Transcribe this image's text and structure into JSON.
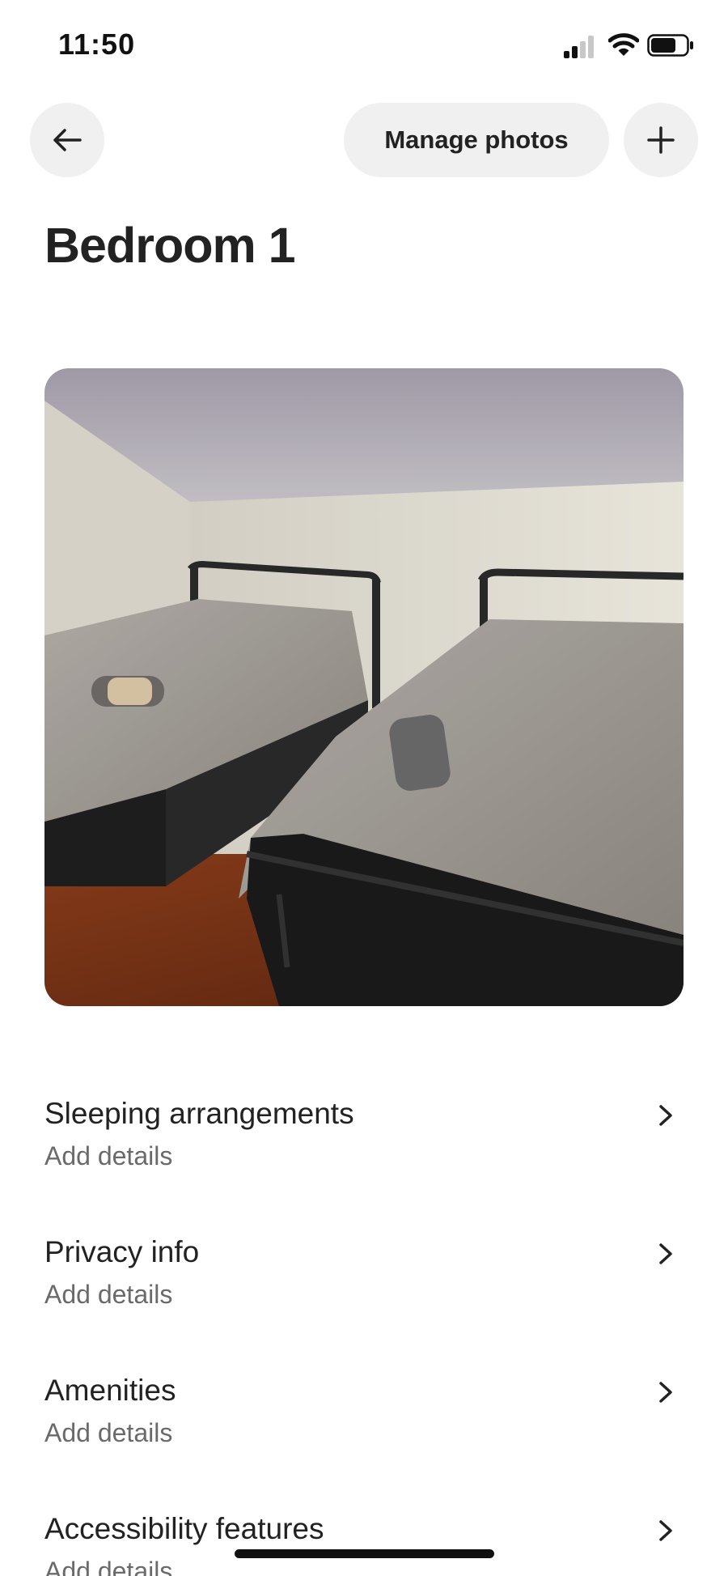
{
  "status_bar": {
    "time": "11:50",
    "icons": [
      "cellular-signal-icon",
      "wifi-icon",
      "battery-icon"
    ]
  },
  "header": {
    "back_icon": "arrow-left-icon",
    "manage_label": "Manage photos",
    "add_icon": "plus-icon"
  },
  "title": "Bedroom 1",
  "photo": {
    "subject": "bedroom-photo"
  },
  "rows": [
    {
      "title": "Sleeping arrangements",
      "subtitle": "Add details"
    },
    {
      "title": "Privacy info",
      "subtitle": "Add details"
    },
    {
      "title": "Amenities",
      "subtitle": "Add details"
    },
    {
      "title": "Accessibility features",
      "subtitle": "Add details"
    }
  ],
  "colors": {
    "button_bg": "#f0f0f0",
    "text_primary": "#222222",
    "text_secondary": "#6a6a6a"
  }
}
